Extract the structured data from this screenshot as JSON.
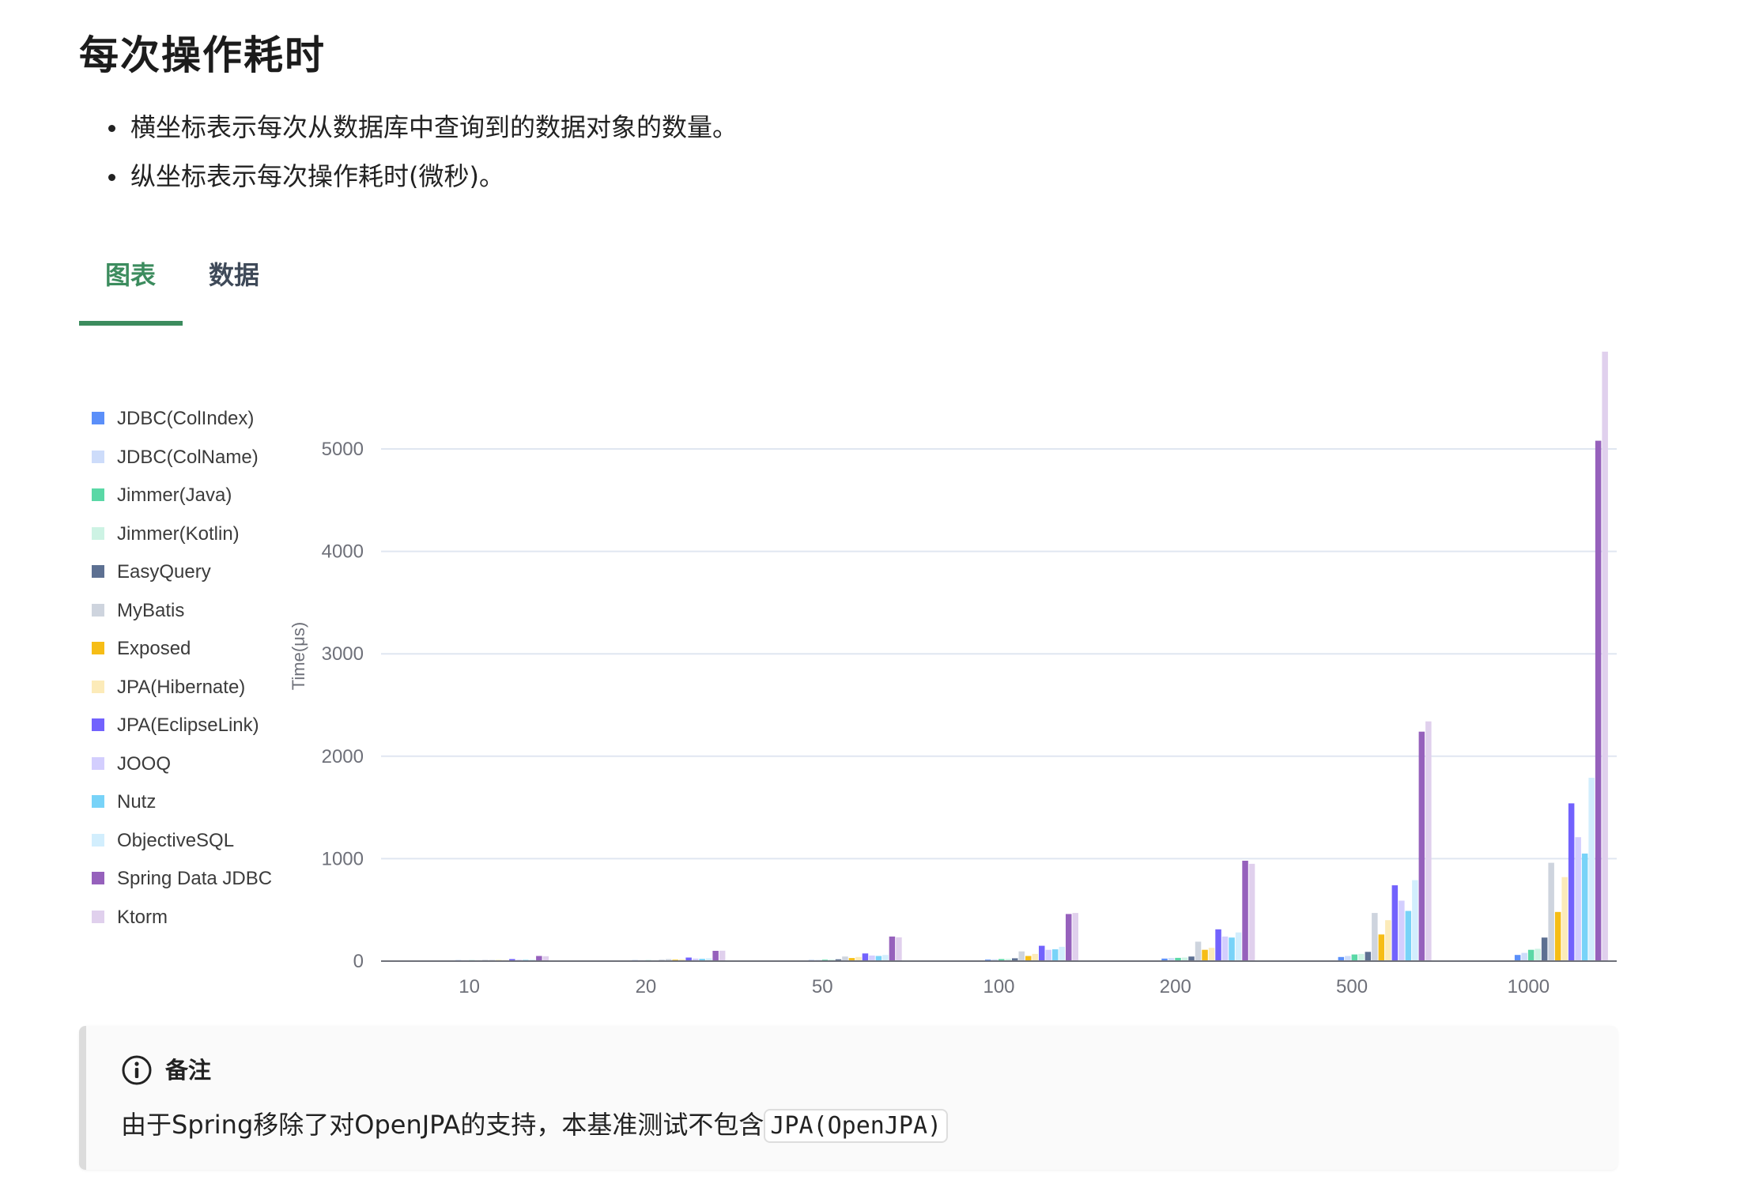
{
  "page": {
    "title": "每次操作耗时",
    "bullets": [
      "横坐标表示每次从数据库中查询到的数据对象的数量。",
      "纵坐标表示每次操作耗时(微秒)。"
    ]
  },
  "tabs": [
    {
      "label": "图表",
      "active": true
    },
    {
      "label": "数据",
      "active": false
    }
  ],
  "colors": {
    "accent": "#3c8c5e"
  },
  "chart_data": {
    "type": "bar",
    "title": "",
    "xlabel": "",
    "ylabel": "Time(μs)",
    "ylim": [
      0,
      5000
    ],
    "yticks": [
      0,
      1000,
      2000,
      3000,
      4000,
      5000
    ],
    "grid": true,
    "legend_position": "left",
    "categories": [
      "10",
      "20",
      "50",
      "100",
      "200",
      "500",
      "1000"
    ],
    "series": [
      {
        "name": "JDBC(ColIndex)",
        "color": "#5b8ff9",
        "values": [
          3,
          5,
          10,
          15,
          25,
          40,
          60
        ]
      },
      {
        "name": "JDBC(ColName)",
        "color": "#cddcfa",
        "values": [
          4,
          6,
          12,
          18,
          30,
          50,
          80
        ]
      },
      {
        "name": "Jimmer(Java)",
        "color": "#5ad8a6",
        "values": [
          4,
          7,
          14,
          20,
          32,
          65,
          110
        ]
      },
      {
        "name": "Jimmer(Kotlin)",
        "color": "#cdf3e4",
        "values": [
          5,
          8,
          15,
          22,
          35,
          70,
          120
        ]
      },
      {
        "name": "EasyQuery",
        "color": "#5d7092",
        "values": [
          6,
          10,
          18,
          28,
          45,
          90,
          230
        ]
      },
      {
        "name": "MyBatis",
        "color": "#ced4de",
        "values": [
          12,
          20,
          45,
          95,
          190,
          470,
          960
        ]
      },
      {
        "name": "Exposed",
        "color": "#f6bd16",
        "values": [
          8,
          14,
          30,
          50,
          110,
          260,
          480
        ]
      },
      {
        "name": "JPA(Hibernate)",
        "color": "#fcebb9",
        "values": [
          10,
          18,
          40,
          70,
          130,
          400,
          820
        ]
      },
      {
        "name": "JPA(EclipseLink)",
        "color": "#7262fd",
        "values": [
          20,
          35,
          75,
          150,
          310,
          740,
          1540
        ]
      },
      {
        "name": "JOOQ",
        "color": "#d3cefe",
        "values": [
          14,
          25,
          55,
          110,
          240,
          590,
          1210
        ]
      },
      {
        "name": "Nutz",
        "color": "#78d3f8",
        "values": [
          12,
          22,
          50,
          115,
          230,
          490,
          1050
        ]
      },
      {
        "name": "ObjectiveSQL",
        "color": "#d2eefd",
        "values": [
          15,
          28,
          60,
          140,
          280,
          790,
          1790
        ]
      },
      {
        "name": "Spring Data JDBC",
        "color": "#9661bc",
        "values": [
          50,
          100,
          240,
          460,
          980,
          2240,
          5080
        ]
      },
      {
        "name": "Ktorm",
        "color": "#e0d0ed",
        "values": [
          48,
          102,
          232,
          470,
          950,
          2340,
          5950
        ]
      }
    ]
  },
  "note": {
    "title": "备注",
    "text": "由于Spring移除了对OpenJPA的支持，本基准测试不包含",
    "code": "JPA(OpenJPA)"
  }
}
